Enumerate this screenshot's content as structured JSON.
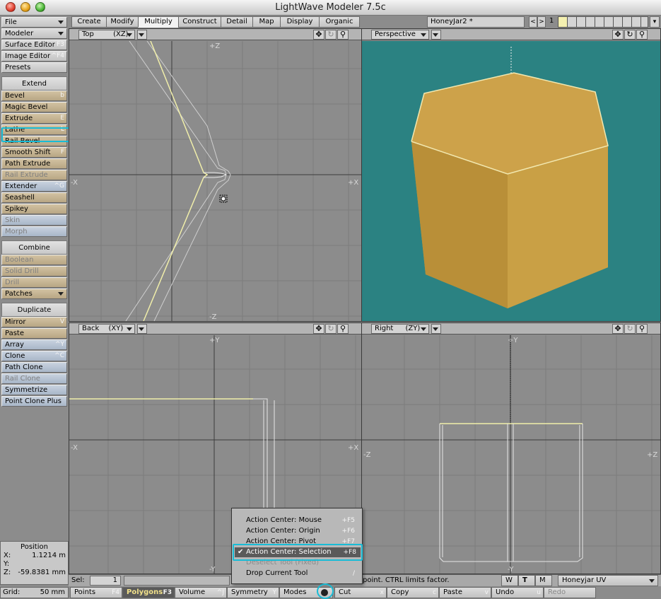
{
  "window": {
    "title": "LightWave Modeler 7.5c"
  },
  "left_toolbar": {
    "file": "File",
    "modeler": "Modeler",
    "surface_editor": {
      "label": "Surface Editor",
      "shortcut": "F3"
    },
    "image_editor": {
      "label": "Image Editor",
      "shortcut": "^F4"
    },
    "presets": "Presets",
    "extend_header": "Extend",
    "extend_items": [
      {
        "label": "Bevel",
        "shortcut": "b"
      },
      {
        "label": "Magic Bevel",
        "shortcut": ""
      },
      {
        "label": "Extrude",
        "shortcut": "E"
      },
      {
        "label": "Lathe",
        "shortcut": "L"
      },
      {
        "label": "Rail Bevel",
        "shortcut": ""
      },
      {
        "label": "Smooth Shift",
        "shortcut": "F"
      },
      {
        "label": "Path Extrude",
        "shortcut": ""
      },
      {
        "label": "Rail Extrude",
        "shortcut": ""
      },
      {
        "label": "Extender",
        "shortcut": "^G"
      },
      {
        "label": "Seashell",
        "shortcut": ""
      },
      {
        "label": "Spikey",
        "shortcut": ""
      },
      {
        "label": "Skin",
        "shortcut": ""
      },
      {
        "label": "Morph",
        "shortcut": ""
      }
    ],
    "combine_header": "Combine",
    "combine_items": [
      {
        "label": "Boolean",
        "shortcut": ""
      },
      {
        "label": "Solid Drill",
        "shortcut": ""
      },
      {
        "label": "Drill",
        "shortcut": ""
      },
      {
        "label": "Patches",
        "shortcut": ""
      }
    ],
    "duplicate_header": "Duplicate",
    "duplicate_items": [
      {
        "label": "Mirror",
        "shortcut": "V"
      },
      {
        "label": "Paste",
        "shortcut": ""
      },
      {
        "label": "Array",
        "shortcut": "^Y"
      },
      {
        "label": "Clone",
        "shortcut": "^C"
      },
      {
        "label": "Path Clone",
        "shortcut": ""
      },
      {
        "label": "Rail Clone",
        "shortcut": ""
      },
      {
        "label": "Symmetrize",
        "shortcut": ""
      },
      {
        "label": "Point Clone Plus",
        "shortcut": ""
      }
    ]
  },
  "position": {
    "title": "Position",
    "x_label": "X:",
    "x_value": "1.1214 m",
    "y_label": "Y:",
    "y_value": "",
    "z_label": "Z:",
    "z_value": "-59.8381 mm"
  },
  "tabs": [
    "Create",
    "Modify",
    "Multiply",
    "Construct",
    "Detail",
    "Map",
    "Display",
    "Organic"
  ],
  "object": {
    "name": "HoneyJar2 *",
    "layer": "1"
  },
  "viewports": {
    "top": {
      "label": "Top",
      "axes": "(XZ)",
      "plus_v": "+Z",
      "minus_v": "-Z",
      "plus_h": "+X",
      "minus_h": "-X"
    },
    "perspective": {
      "label": "Perspective",
      "bg": "#2b8282"
    },
    "back": {
      "label": "Back",
      "axes": "(XY)",
      "plus_v": "+Y",
      "minus_v": "-Y",
      "plus_h": "+X",
      "minus_h": "-X"
    },
    "right": {
      "label": "Right",
      "axes": "(ZY)",
      "plus_v": "+Y",
      "minus_v": "-Y",
      "plus_h": "+Z",
      "minus_h": "-Z"
    }
  },
  "status": {
    "sel_label": "Sel:",
    "sel_value": "1",
    "hint": "point. CTRL limits factor.",
    "w": "W",
    "t": "T",
    "m": "M",
    "uv_map": "Honeyjar UV"
  },
  "bottom": {
    "grid_label": "Grid:",
    "grid_value": "50 mm",
    "points": {
      "label": "Points",
      "shortcut": "F4"
    },
    "polygons": {
      "label": "Polygons",
      "shortcut": "F3"
    },
    "volume": {
      "label": "Volume",
      "shortcut": "^J"
    },
    "symmetry": {
      "label": "Symmetry",
      "shortcut": "Y"
    },
    "modes": "Modes",
    "cut": {
      "label": "Cut",
      "shortcut": "x"
    },
    "copy": {
      "label": "Copy",
      "shortcut": "c"
    },
    "paste": {
      "label": "Paste",
      "shortcut": "v"
    },
    "undo": {
      "label": "Undo",
      "shortcut": "u"
    },
    "redo": {
      "label": "Redo",
      "shortcut": ""
    }
  },
  "modes_menu": [
    {
      "label": "Action Center: Mouse",
      "shortcut": "+F5"
    },
    {
      "label": "Action Center: Origin",
      "shortcut": "+F6"
    },
    {
      "label": "Action Center: Pivot",
      "shortcut": "+F7"
    },
    {
      "label": "Action Center: Selection",
      "shortcut": "+F8",
      "checked": true
    },
    {
      "label": "Deselect Tool (Fixed)",
      "shortcut": ""
    },
    {
      "label": "Drop Current Tool",
      "shortcut": "/"
    }
  ],
  "colors": {
    "highlight": "#18bcd6",
    "jar": "#c39a40",
    "perspective_bg": "#2b8282"
  }
}
